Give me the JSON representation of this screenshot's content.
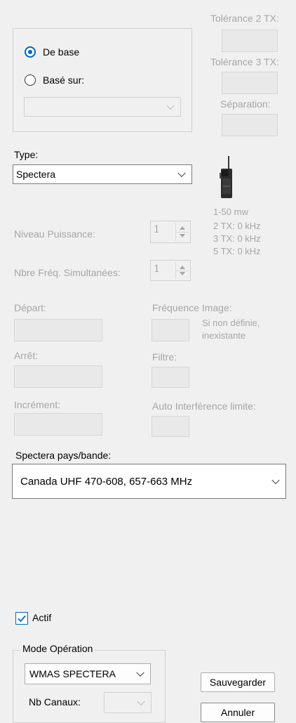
{
  "tolerance": {
    "tx2_label": "Tolérance 2 TX:",
    "tx3_label": "Tolérance 3 TX:",
    "separation_label": "Séparation:"
  },
  "basis_group": {
    "option_base": "De base",
    "option_based_on": "Basé sur:",
    "selected": "De base",
    "based_on_value": ""
  },
  "type": {
    "label": "Type:",
    "value": "Spectera"
  },
  "device_info": {
    "image_icon": "bodypack-transmitter-icon",
    "power": "1-50 mw",
    "tx2": "2 TX: 0 kHz",
    "tx3": "3 TX: 0 kHz",
    "tx5": "5 TX: 0 kHz"
  },
  "power_level": {
    "label": "Niveau Puissance:",
    "value": "1"
  },
  "simultaneous": {
    "label": "Nbre Fréq. Simultanées:",
    "value": "1"
  },
  "frequency": {
    "start_label": "Départ:",
    "stop_label": "Arrêt:",
    "increment_label": "Incrément:",
    "image_label": "Fréquence Image:",
    "image_note_line1": "Si non définie,",
    "image_note_line2": "inexistante",
    "filter_label": "Filtre:",
    "auto_interference_label": "Auto Interférence limite:"
  },
  "band": {
    "label": "Spectera pays/bande:",
    "value": "Canada UHF 470-608, 657-663 MHz"
  },
  "active": {
    "label": "Actif",
    "checked": true
  },
  "mode": {
    "group_label": "Mode Opération",
    "value": "WMAS SPECTERA",
    "channels_label": "Nb Canaux:",
    "channels_value": ""
  },
  "buttons": {
    "save": "Sauvegarder",
    "cancel": "Annuler"
  },
  "colors": {
    "accent": "#0067c0",
    "disabled_text": "#a6a6a6",
    "background": "#f0f0f0"
  }
}
